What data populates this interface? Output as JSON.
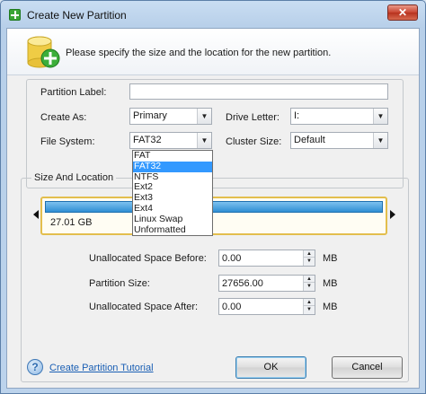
{
  "window": {
    "title": "Create New Partition",
    "close_glyph": "✕"
  },
  "header": {
    "instruction": "Please specify the size and the location for the new partition.",
    "icon": "disk-add-icon"
  },
  "form": {
    "partition_label": {
      "label": "Partition Label:",
      "value": ""
    },
    "create_as": {
      "label": "Create As:",
      "value": "Primary"
    },
    "drive_letter": {
      "label": "Drive Letter:",
      "value": "I:"
    },
    "file_system": {
      "label": "File System:",
      "value": "FAT32",
      "options": [
        "FAT",
        "FAT32",
        "NTFS",
        "Ext2",
        "Ext3",
        "Ext4",
        "Linux Swap",
        "Unformatted"
      ],
      "highlighted": "FAT32"
    },
    "cluster_size": {
      "label": "Cluster Size:",
      "value": "Default"
    }
  },
  "location": {
    "group_title": "Size And Location",
    "bar_label": "27.01 GB",
    "fill_fraction": 1.0,
    "unallocated_before": {
      "label": "Unallocated Space Before:",
      "value": "0.00",
      "unit": "MB"
    },
    "partition_size": {
      "label": "Partition Size:",
      "value": "27656.00",
      "unit": "MB"
    },
    "unallocated_after": {
      "label": "Unallocated Space After:",
      "value": "0.00",
      "unit": "MB"
    }
  },
  "footer": {
    "help_glyph": "?",
    "tutorial_link": "Create Partition Tutorial",
    "ok_label": "OK",
    "cancel_label": "Cancel"
  },
  "colors": {
    "accent_blue": "#3399ff",
    "title_bar": "#b7cfe9",
    "bar_fill": "#2f8fd3",
    "bar_border": "#e3be4d"
  }
}
